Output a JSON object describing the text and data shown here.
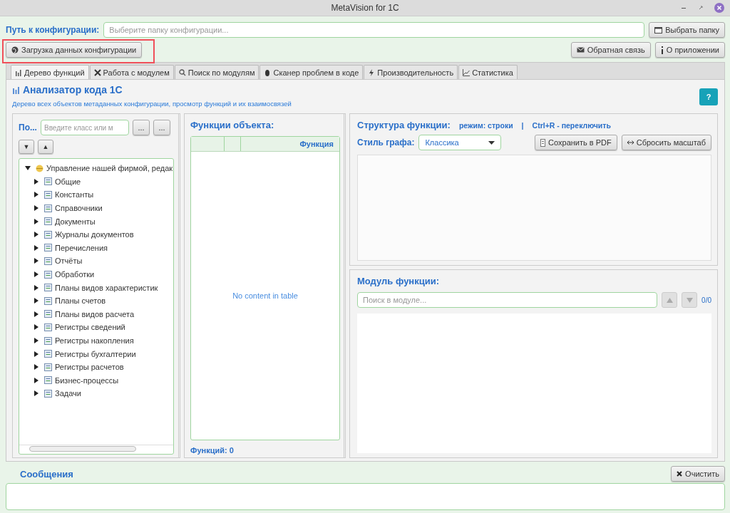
{
  "window": {
    "title": "MetaVision for 1C"
  },
  "path": {
    "label": "Путь к конфигурации:",
    "placeholder": "Выберите папку конфигурации...",
    "browse_button": "Выбрать папку"
  },
  "toolbar": {
    "load_button": "Загрузка данных конфигурации",
    "feedback_button": "Обратная связь",
    "about_button": "О приложении"
  },
  "tabs": [
    {
      "label": "Дерево функций",
      "selected": true
    },
    {
      "label": "Работа с модулем",
      "selected": false
    },
    {
      "label": "Поиск по модулям",
      "selected": false
    },
    {
      "label": "Сканер проблем в коде",
      "selected": false
    },
    {
      "label": "Производительность",
      "selected": false
    },
    {
      "label": "Статистика",
      "selected": false
    }
  ],
  "header": {
    "title": "Анализатор кода 1С",
    "subtitle": "Дерево всех объектов метаданных конфигурации, просмотр функций и их взаимосвязей",
    "help_button": "?"
  },
  "tree_panel": {
    "search_label": "По...",
    "search_placeholder": "Введите класс или м",
    "button_1": "...",
    "button_2": "...",
    "expand_button": "▼",
    "collapse_button": "▲",
    "tree": [
      {
        "label": "Управление нашей фирмой, редак",
        "expanded": true,
        "children": [
          {
            "label": "Общие",
            "expanded": false
          },
          {
            "label": "Константы",
            "expanded": false
          },
          {
            "label": "Справочники",
            "expanded": false
          },
          {
            "label": "Документы",
            "expanded": false
          },
          {
            "label": "Журналы документов",
            "expanded": false
          },
          {
            "label": "Перечисления",
            "expanded": false
          },
          {
            "label": "Отчёты",
            "expanded": false
          },
          {
            "label": "Обработки",
            "expanded": false
          },
          {
            "label": "Планы видов характеристик",
            "expanded": false
          },
          {
            "label": "Планы счетов",
            "expanded": false
          },
          {
            "label": "Планы видов расчета",
            "expanded": false
          },
          {
            "label": "Регистры сведений",
            "expanded": false
          },
          {
            "label": "Регистры накопления",
            "expanded": false
          },
          {
            "label": "Регистры бухгалтерии",
            "expanded": false
          },
          {
            "label": "Регистры расчетов",
            "expanded": false
          },
          {
            "label": "Бизнес-процессы",
            "expanded": false
          },
          {
            "label": "Задачи",
            "expanded": false
          }
        ]
      }
    ]
  },
  "functions_panel": {
    "title": "Функции объекта:",
    "columns": [
      "Функция"
    ],
    "empty_text": "No content in table",
    "count": "Функций: 0"
  },
  "structure_panel": {
    "title": "Структура функции:",
    "mode": "режим: строки",
    "separator": "|",
    "shortcut": "Ctrl+R - переключить",
    "style_label": "Стиль графа:",
    "style_value": "Классика",
    "pdf_button": "Сохранить в PDF",
    "reset_button": "Сбросить масштаб"
  },
  "module_panel": {
    "title": "Модуль функции:",
    "search_placeholder": "Поиск в модуле...",
    "up_disabled": true,
    "down_disabled": true,
    "counter": "0/0"
  },
  "messages": {
    "title": "Сообщения",
    "clear_button": "Очистить"
  },
  "annotation": {
    "kind": "highlight"
  }
}
